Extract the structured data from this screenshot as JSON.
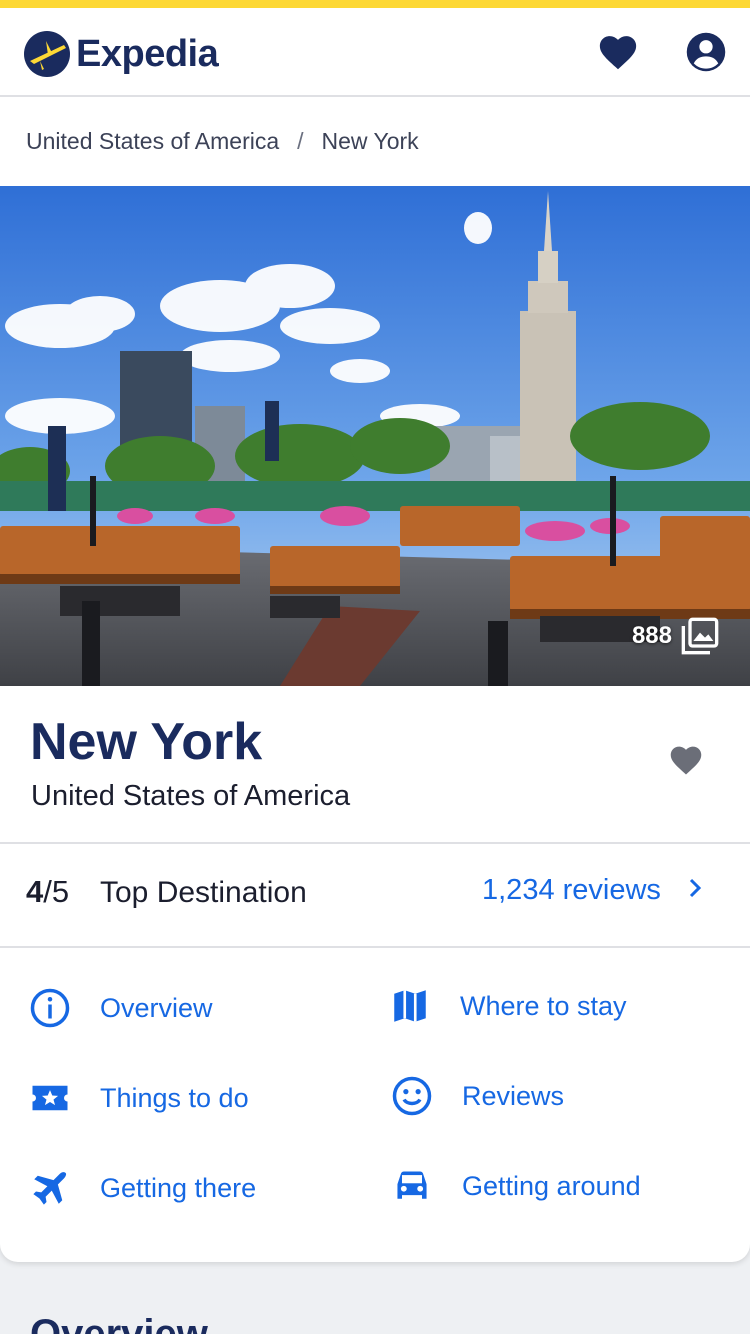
{
  "header": {
    "logo_text": "Expedia"
  },
  "breadcrumb": {
    "items": [
      "United States of America",
      "New York"
    ],
    "separator": "/"
  },
  "hero": {
    "photo_count": "888"
  },
  "destination": {
    "title": "New York",
    "subtitle": "United States of America"
  },
  "rating": {
    "score": "4",
    "out_of": "/5",
    "label": "Top Destination",
    "reviews_link": "1,234 reviews"
  },
  "nav": {
    "overview": "Overview",
    "where_to_stay": "Where to stay",
    "things_to_do": "Things to do",
    "reviews": "Reviews",
    "getting_there": "Getting there",
    "getting_around": "Getting around"
  },
  "next_section": {
    "title": "Overview"
  },
  "colors": {
    "brand_yellow": "#fdd835",
    "brand_navy": "#1a2b5e",
    "link_blue": "#1668e3"
  },
  "icons": [
    "heart-icon",
    "account-icon",
    "gallery-icon",
    "info-icon",
    "map-icon",
    "ticket-star-icon",
    "smiley-icon",
    "airplane-icon",
    "car-icon",
    "chevron-right-icon"
  ]
}
